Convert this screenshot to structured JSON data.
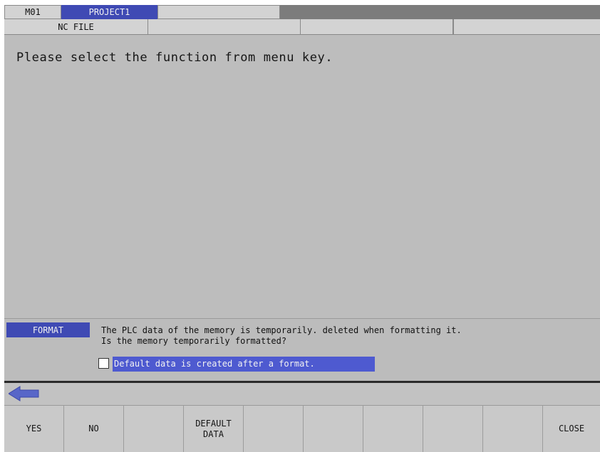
{
  "tabs": {
    "machine": "M01",
    "project": "PROJECT1",
    "empty": ""
  },
  "file_row": {
    "nc_file": "NC FILE",
    "cell2": "",
    "cell3": "",
    "cell4": "",
    "cell5": ""
  },
  "main": {
    "message": "Please select the function from menu key."
  },
  "dialog": {
    "label": "FORMAT",
    "line1": "The PLC data of the memory is temporarily. deleted when formatting it.",
    "line2": "Is the memory temporarily formatted?",
    "option_text": "Default data is created after a format.",
    "option_checked": false
  },
  "nav": {
    "back_icon": "left-arrow-icon"
  },
  "menu_keys": {
    "yes": "YES",
    "no": "NO",
    "key3": "",
    "default_data": "DEFAULT\nDATA",
    "key5": "",
    "key6": "",
    "key7": "",
    "key8": "",
    "key9": "",
    "close": "CLOSE"
  },
  "colors": {
    "accent_blue": "#3f4ab4",
    "highlight_blue": "#4e5ad0",
    "panel_gray": "#bdbdbd",
    "arrow_blue": "#5866c8"
  }
}
